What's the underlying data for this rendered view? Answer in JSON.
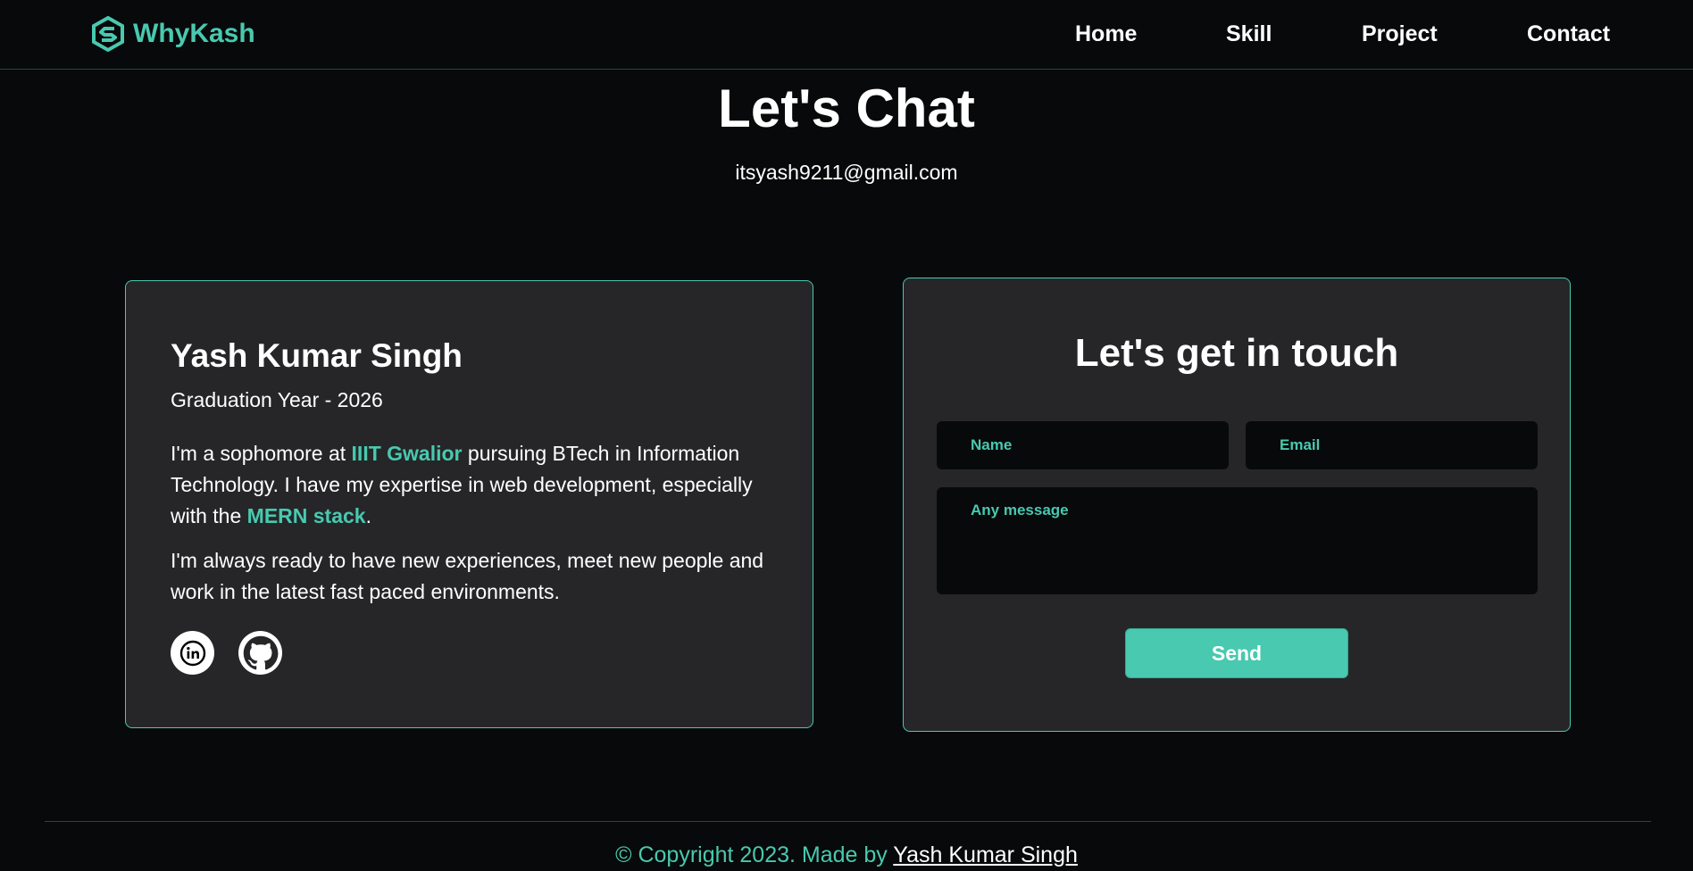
{
  "nav": {
    "brand": "WhyKash",
    "links": [
      "Home",
      "Skill",
      "Project",
      "Contact"
    ]
  },
  "hero": {
    "title": "Let's Chat",
    "email": "itsyash9211@gmail.com"
  },
  "about": {
    "name": "Yash Kumar Singh",
    "graduation": "Graduation Year - 2026",
    "para1_a": "I'm a sophomore at ",
    "para1_highlight1": "IIIT Gwalior",
    "para1_b": " pursuing BTech in Information Technology. I have my expertise in web development, especially with the ",
    "para1_highlight2": "MERN stack",
    "para1_c": ".",
    "para2": "I'm always ready to have new experiences, meet new people and work in the latest fast paced environments."
  },
  "contact_form": {
    "heading": "Let's get in touch",
    "name_placeholder": "Name",
    "email_placeholder": "Email",
    "message_placeholder": "Any message",
    "send_label": "Send"
  },
  "footer": {
    "prefix": "© Copyright 2023. Made by ",
    "author": "Yash Kumar Singh"
  },
  "colors": {
    "accent": "#48c9b0",
    "background": "#08090a",
    "card": "#262628"
  }
}
